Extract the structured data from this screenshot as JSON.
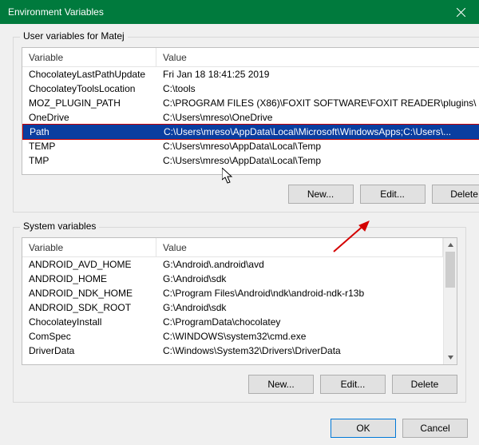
{
  "window": {
    "title": "Environment Variables",
    "close_icon": "close"
  },
  "user_vars": {
    "label": "User variables for Matej",
    "col_variable": "Variable",
    "col_value": "Value",
    "rows": [
      {
        "name": "ChocolateyLastPathUpdate",
        "value": "Fri Jan 18 18:41:25 2019"
      },
      {
        "name": "ChocolateyToolsLocation",
        "value": "C:\\tools"
      },
      {
        "name": "MOZ_PLUGIN_PATH",
        "value": "C:\\PROGRAM FILES (X86)\\FOXIT SOFTWARE\\FOXIT READER\\plugins\\"
      },
      {
        "name": "OneDrive",
        "value": "C:\\Users\\mreso\\OneDrive"
      },
      {
        "name": "Path",
        "value": "C:\\Users\\mreso\\AppData\\Local\\Microsoft\\WindowsApps;C:\\Users\\...",
        "selected": true
      },
      {
        "name": "TEMP",
        "value": "C:\\Users\\mreso\\AppData\\Local\\Temp"
      },
      {
        "name": "TMP",
        "value": "C:\\Users\\mreso\\AppData\\Local\\Temp"
      }
    ],
    "buttons": {
      "new": "New...",
      "edit": "Edit...",
      "delete": "Delete"
    },
    "scroll": {
      "thumb_top": 0,
      "thumb_height": 70
    }
  },
  "system_vars": {
    "label": "System variables",
    "col_variable": "Variable",
    "col_value": "Value",
    "rows": [
      {
        "name": "ANDROID_AVD_HOME",
        "value": "G:\\Android\\.android\\avd"
      },
      {
        "name": "ANDROID_HOME",
        "value": "G:\\Android\\sdk"
      },
      {
        "name": "ANDROID_NDK_HOME",
        "value": "C:\\Program Files\\Android\\ndk\\android-ndk-r13b"
      },
      {
        "name": "ANDROID_SDK_ROOT",
        "value": "G:\\Android\\sdk"
      },
      {
        "name": "ChocolateyInstall",
        "value": "C:\\ProgramData\\chocolatey"
      },
      {
        "name": "ComSpec",
        "value": "C:\\WINDOWS\\system32\\cmd.exe"
      },
      {
        "name": "DriverData",
        "value": "C:\\Windows\\System32\\Drivers\\DriverData"
      }
    ],
    "buttons": {
      "new": "New...",
      "edit": "Edit...",
      "delete": "Delete"
    },
    "scroll": {
      "thumb_top": 0,
      "thumb_height": 45
    }
  },
  "dialog_buttons": {
    "ok": "OK",
    "cancel": "Cancel"
  }
}
